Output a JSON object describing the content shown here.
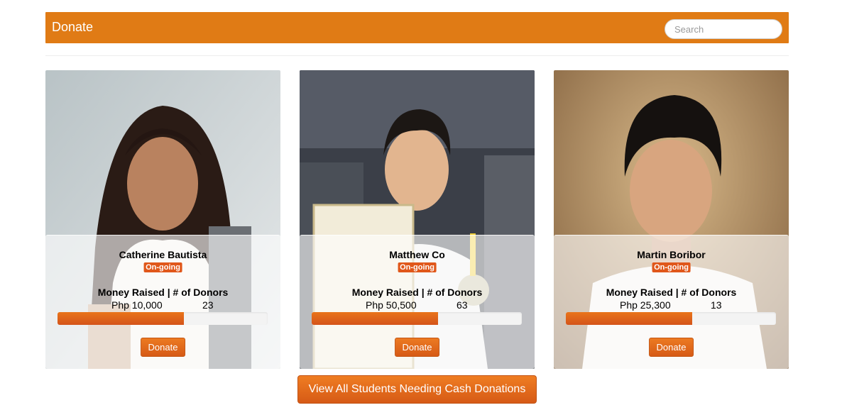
{
  "header": {
    "brand": "Donate",
    "search_placeholder": "Search",
    "accent_color": "#e07b15"
  },
  "cards": [
    {
      "name": "Catherine Bautista",
      "status": "On-going",
      "metric_label": "Money Raised | # of Donors",
      "money_raised": "Php 10,000",
      "donors": "23",
      "progress_pct": 60,
      "button_label": "Donate",
      "photo_icon": "student-photo"
    },
    {
      "name": "Matthew Co",
      "status": "On-going",
      "metric_label": "Money Raised | # of Donors",
      "money_raised": "Php 50,500",
      "donors": "63",
      "progress_pct": 60,
      "button_label": "Donate",
      "photo_icon": "student-photo"
    },
    {
      "name": "Martin Boribor",
      "status": "On-going",
      "metric_label": "Money Raised | # of Donors",
      "money_raised": "Php 25,300",
      "donors": "13",
      "progress_pct": 60,
      "button_label": "Donate",
      "photo_icon": "student-photo"
    }
  ],
  "footer": {
    "view_all_label": "View All Students Needing Cash Donations"
  },
  "colors": {
    "button": "#e0641b",
    "badge": "#e0571a"
  }
}
